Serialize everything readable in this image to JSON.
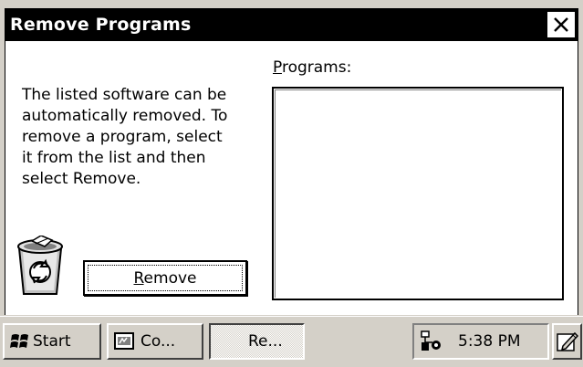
{
  "window": {
    "title": "Remove Programs",
    "close_icon": "close-icon"
  },
  "main": {
    "description": "The listed software can be\nautomatically removed. To\nremove a program, select\nit from the list and then\nselect Remove.",
    "programs_label": "Programs:",
    "programs_label_mnemonic": "P",
    "programs": [],
    "remove_button": "Remove",
    "recycle_icon": "recycle-bin-icon"
  },
  "taskbar": {
    "start_label": "Start",
    "items": [
      {
        "label": "Co...",
        "icon": "control-panel-icon",
        "active": false
      },
      {
        "label": "Re...",
        "icon": "none",
        "active": true
      }
    ],
    "clock": "5:38 PM",
    "network_icon": "network-icon",
    "input_icon": "pencil-icon"
  },
  "colors": {
    "title_bar": "#000000",
    "title_text": "#ffffff",
    "face": "#d4d0c8",
    "window_bg": "#ffffff"
  }
}
